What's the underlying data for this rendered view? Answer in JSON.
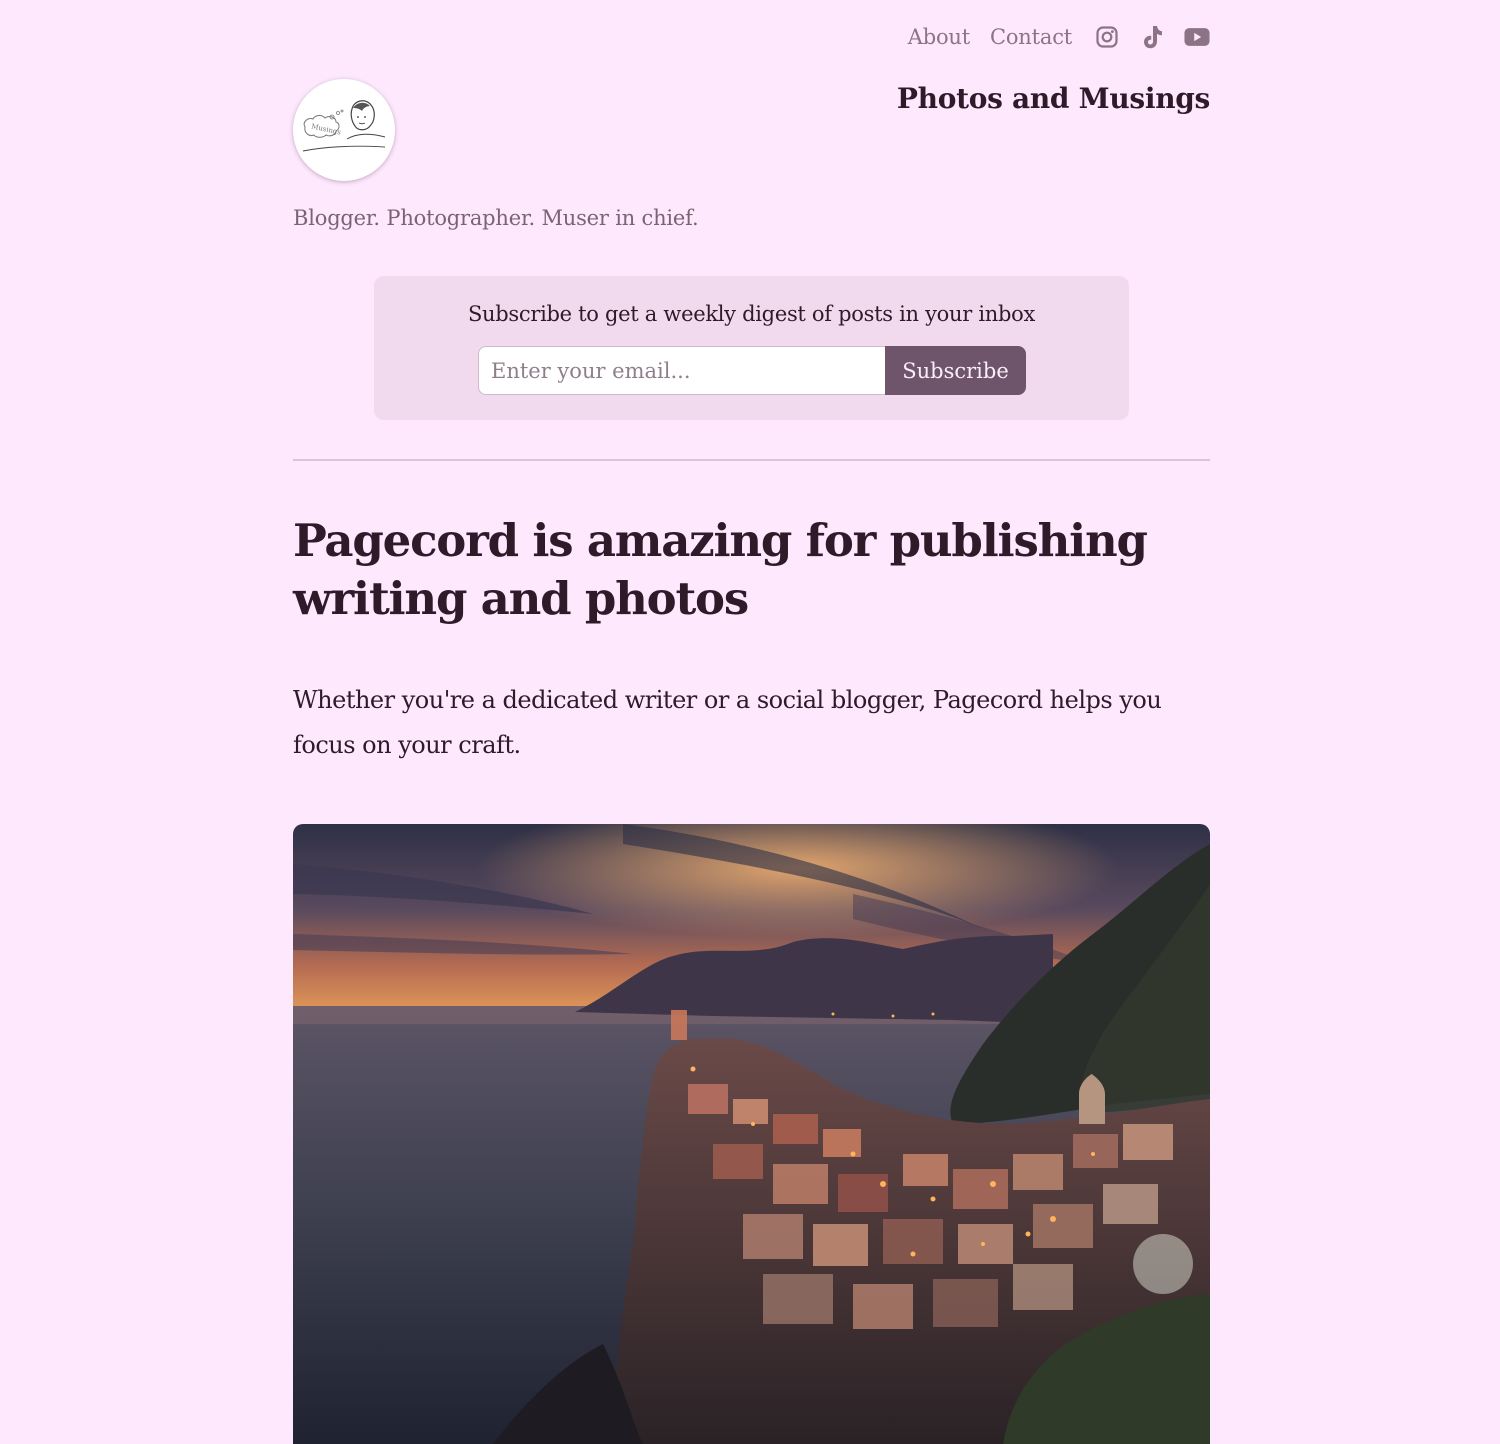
{
  "nav": {
    "about_label": "About",
    "contact_label": "Contact",
    "social": [
      "instagram-icon",
      "tiktok-icon",
      "youtube-icon"
    ]
  },
  "site": {
    "title": "Photos and Musings",
    "tagline": "Blogger. Photographer. Muser in chief.",
    "avatar_text": "Musings"
  },
  "subscribe": {
    "label": "Subscribe to get a weekly digest of posts in your inbox",
    "placeholder": "Enter your email...",
    "button_label": "Subscribe"
  },
  "post": {
    "title": "Pagecord is amazing for publishing writing and photos",
    "body": "Whether you're a dedicated writer or a social blogger, Pagecord helps you focus on your craft."
  },
  "colors": {
    "background": "#fde8fd",
    "accent": "#6f556b",
    "text": "#2e1a28",
    "muted": "#8c7486"
  }
}
